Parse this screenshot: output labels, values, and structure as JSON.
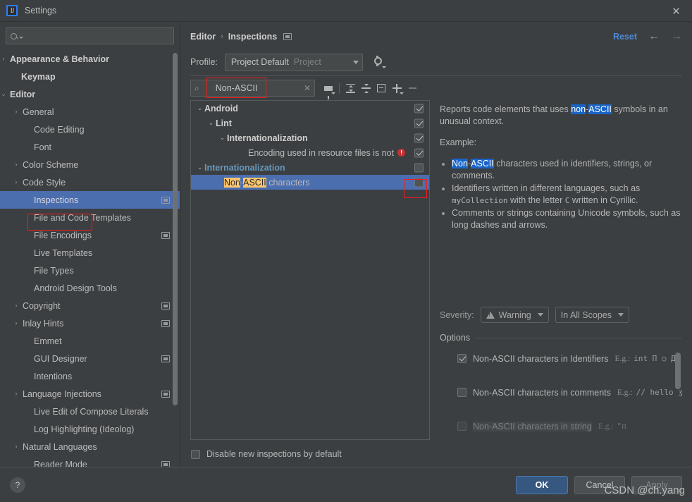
{
  "window": {
    "title": "Settings",
    "logo_text": "IJ",
    "close_icon": "✕"
  },
  "sidebar": {
    "search_placeholder": "",
    "items": [
      {
        "label": "Appearance & Behavior",
        "arrow": "›",
        "bold": true,
        "indent": 10,
        "badge": false,
        "selected": false
      },
      {
        "label": "Keymap",
        "arrow": "",
        "bold": true,
        "indent": 26,
        "badge": false,
        "selected": false
      },
      {
        "label": "Editor",
        "arrow": "⌄",
        "bold": true,
        "indent": 10,
        "badge": false,
        "selected": false
      },
      {
        "label": "General",
        "arrow": "›",
        "bold": false,
        "indent": 28,
        "badge": false,
        "selected": false
      },
      {
        "label": "Code Editing",
        "arrow": "",
        "bold": false,
        "indent": 44,
        "badge": false,
        "selected": false
      },
      {
        "label": "Font",
        "arrow": "",
        "bold": false,
        "indent": 44,
        "badge": false,
        "selected": false
      },
      {
        "label": "Color Scheme",
        "arrow": "›",
        "bold": false,
        "indent": 28,
        "badge": false,
        "selected": false
      },
      {
        "label": "Code Style",
        "arrow": "›",
        "bold": false,
        "indent": 28,
        "badge": false,
        "selected": false
      },
      {
        "label": "Inspections",
        "arrow": "",
        "bold": false,
        "indent": 44,
        "badge": true,
        "selected": true
      },
      {
        "label": "File and Code Templates",
        "arrow": "",
        "bold": false,
        "indent": 44,
        "badge": false,
        "selected": false
      },
      {
        "label": "File Encodings",
        "arrow": "",
        "bold": false,
        "indent": 44,
        "badge": true,
        "selected": false
      },
      {
        "label": "Live Templates",
        "arrow": "",
        "bold": false,
        "indent": 44,
        "badge": false,
        "selected": false
      },
      {
        "label": "File Types",
        "arrow": "",
        "bold": false,
        "indent": 44,
        "badge": false,
        "selected": false
      },
      {
        "label": "Android Design Tools",
        "arrow": "",
        "bold": false,
        "indent": 44,
        "badge": false,
        "selected": false
      },
      {
        "label": "Copyright",
        "arrow": "›",
        "bold": false,
        "indent": 28,
        "badge": true,
        "selected": false
      },
      {
        "label": "Inlay Hints",
        "arrow": "›",
        "bold": false,
        "indent": 28,
        "badge": true,
        "selected": false
      },
      {
        "label": "Emmet",
        "arrow": "",
        "bold": false,
        "indent": 44,
        "badge": false,
        "selected": false
      },
      {
        "label": "GUI Designer",
        "arrow": "",
        "bold": false,
        "indent": 44,
        "badge": true,
        "selected": false
      },
      {
        "label": "Intentions",
        "arrow": "",
        "bold": false,
        "indent": 44,
        "badge": false,
        "selected": false
      },
      {
        "label": "Language Injections",
        "arrow": "›",
        "bold": false,
        "indent": 28,
        "badge": true,
        "selected": false
      },
      {
        "label": "Live Edit of Compose Literals",
        "arrow": "",
        "bold": false,
        "indent": 44,
        "badge": false,
        "selected": false
      },
      {
        "label": "Log Highlighting (Ideolog)",
        "arrow": "",
        "bold": false,
        "indent": 44,
        "badge": false,
        "selected": false
      },
      {
        "label": "Natural Languages",
        "arrow": "›",
        "bold": false,
        "indent": 28,
        "badge": false,
        "selected": false
      },
      {
        "label": "Reader Mode",
        "arrow": "",
        "bold": false,
        "indent": 44,
        "badge": true,
        "selected": false
      }
    ]
  },
  "header": {
    "breadcrumb_parent": "Editor",
    "breadcrumb_sep": "›",
    "breadcrumb_current": "Inspections",
    "reset_label": "Reset",
    "back_arrow": "←",
    "forward_arrow": "→"
  },
  "profile": {
    "label": "Profile:",
    "value": "Project Default",
    "scope": "Project",
    "gear_icon": "gear-icon"
  },
  "toolbar": {
    "search_value": "Non-ASCII",
    "clear_icon": "✕",
    "icons": [
      "filter-icon",
      "expand-all-icon",
      "collapse-all-icon",
      "group-by-icon",
      "add-icon",
      "remove-icon"
    ]
  },
  "inspection_tree": [
    {
      "label": "Android",
      "indent": 6,
      "arrow": "⌄",
      "style": "bold",
      "checkbox": "checked",
      "error": false
    },
    {
      "label": "Lint",
      "indent": 22,
      "arrow": "⌄",
      "style": "bold",
      "checkbox": "checked",
      "error": false
    },
    {
      "label": "Internationalization",
      "indent": 38,
      "arrow": "⌄",
      "style": "bold",
      "checkbox": "checked",
      "error": false
    },
    {
      "label": "Encoding used in resource files is not",
      "indent": 68,
      "arrow": "",
      "style": "normal",
      "checkbox": "checked",
      "error": true
    },
    {
      "label": "Internationalization",
      "indent": 6,
      "arrow": "⌄",
      "style": "blue",
      "checkbox": "empty",
      "error": false
    },
    {
      "label": "Non-ASCII characters",
      "indent": 34,
      "arrow": "",
      "style": "highlighted",
      "checkbox": "empty",
      "error": false,
      "selected": true,
      "parts": [
        {
          "t": "Non",
          "hl": true
        },
        {
          "t": "-",
          "hl": false
        },
        {
          "t": "ASCII",
          "hl": true
        },
        {
          "t": " characters",
          "hl": false
        }
      ]
    }
  ],
  "description": {
    "intro_prefix": "Reports code elements that uses ",
    "intro_hl1": "non",
    "intro_dash": "-",
    "intro_hl2": "ASCII",
    "intro_suffix": " symbols in an unusual context.",
    "example_label": "Example:",
    "bullets": [
      {
        "hl1": "Non",
        "dash": "-",
        "hl2": "ASCII",
        "rest": " characters used in identifiers, strings, or comments."
      },
      {
        "pre": "Identifiers written in different languages, such as ",
        "code": "myCollection",
        "mid": " with the letter ",
        "code2": "C",
        "post": " written in Cyrillic."
      },
      {
        "plain": "Comments or strings containing Unicode symbols, such as long dashes and arrows."
      }
    ]
  },
  "severity": {
    "label": "Severity:",
    "level": "Warning",
    "scope": "In All Scopes",
    "warning_icon": "warning-triangle-icon"
  },
  "options": {
    "title": "Options",
    "rows": [
      {
        "label": "Non-ASCII characters in Identifiers",
        "checked": true,
        "eg": "E.g.:",
        "code": "int Π ○ Д"
      },
      {
        "label": "Non-ASCII characters in comments",
        "checked": false,
        "eg": "E.g.:",
        "code": "// hello ʒ"
      },
      {
        "label": "Non-ASCII characters in string",
        "checked": false,
        "eg": "E.g.:",
        "code": "\"п"
      }
    ]
  },
  "bottom": {
    "disable_new_label": "Disable new inspections by default",
    "disable_new_checked": false,
    "help_icon": "?",
    "ok_label": "OK",
    "cancel_label": "Cancel",
    "apply_label": "Apply"
  },
  "watermark": {
    "text": "CSDN @ch.yang"
  },
  "colors": {
    "background": "#3c3f41",
    "selection_blue": "#4b6eaf",
    "accent_link": "#4a88d6",
    "primary_button": "#365880",
    "highlight_yellow": "#ffc66d",
    "highlight_blue": "#1a64c8",
    "error_red": "#c53232",
    "annotation_red": "#f41b1b"
  }
}
